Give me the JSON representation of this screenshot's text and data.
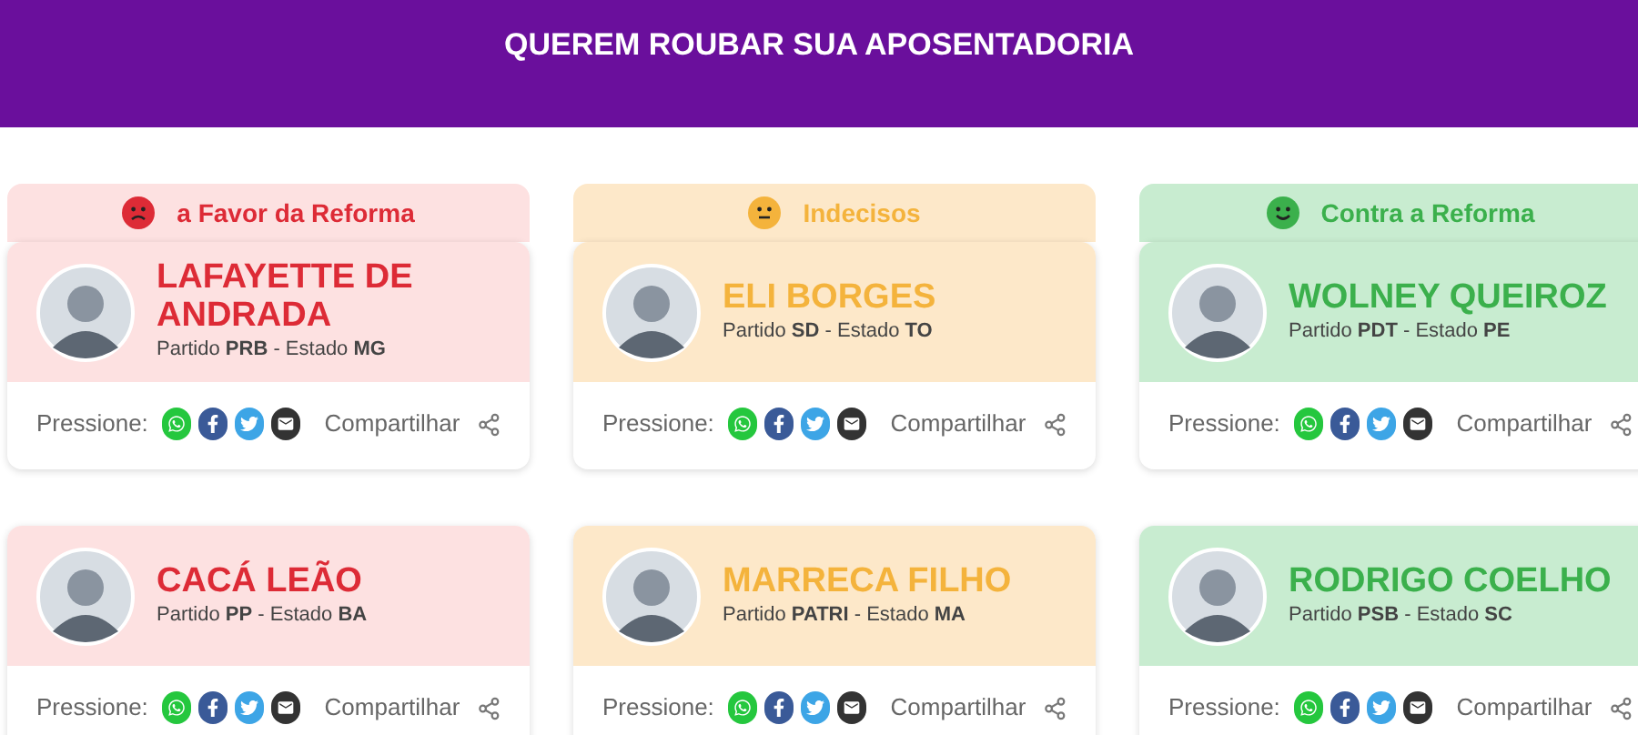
{
  "header": {
    "title": "QUEREM ROUBAR SUA APOSENTADORIA"
  },
  "columns": [
    {
      "kind": "favor",
      "label": "a Favor da Reforma",
      "cards": [
        {
          "name": "LAFAYETTE DE ANDRADA",
          "info": "Partido **PRB** - Estado **MG**",
          "press_label": "Pressione:",
          "share_label": "Compartilhar"
        },
        {
          "name": "CACÁ LEÃO",
          "info": "Partido **PP** - Estado **BA**",
          "press_label": "Pressione:",
          "share_label": "Compartilhar"
        }
      ]
    },
    {
      "kind": "undecided",
      "label": "Indecisos",
      "cards": [
        {
          "name": "ELI BORGES",
          "info": "Partido **SD** - Estado **TO**",
          "press_label": "Pressione:",
          "share_label": "Compartilhar"
        },
        {
          "name": "MARRECA FILHO",
          "info": "Partido **PATRI** - Estado **MA**",
          "press_label": "Pressione:",
          "share_label": "Compartilhar"
        }
      ]
    },
    {
      "kind": "against",
      "label": "Contra a Reforma",
      "cards": [
        {
          "name": "WOLNEY QUEIROZ",
          "info": "Partido **PDT** - Estado **PE**",
          "press_label": "Pressione:",
          "share_label": "Compartilhar"
        },
        {
          "name": "RODRIGO COELHO",
          "info": "Partido **PSB** - Estado **SC**",
          "press_label": "Pressione:",
          "share_label": "Compartilhar"
        }
      ]
    }
  ]
}
